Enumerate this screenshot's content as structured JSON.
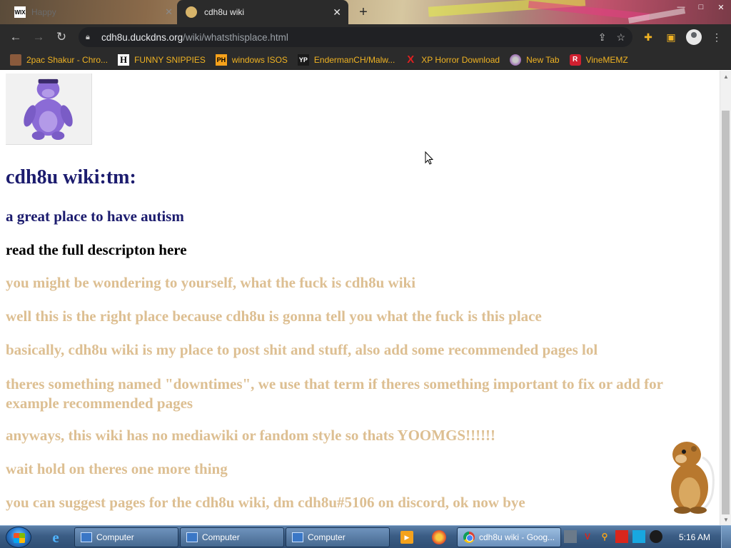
{
  "tabs": [
    {
      "title": "Happy",
      "favicon": "wix-icon",
      "active": false
    },
    {
      "title": "cdh8u wiki",
      "favicon": "site-icon",
      "active": true
    }
  ],
  "window_controls": {
    "minimize": "—",
    "maximize": "□",
    "close": "✕"
  },
  "address_bar": {
    "domain": "cdh8u.duckdns.org",
    "path": "/wiki/whatsthisplace.html"
  },
  "bookmarks": [
    {
      "label": "2pac Shakur - Chro...",
      "icon": "bookmark-photo-icon"
    },
    {
      "label": "FUNNY SNIPPIES",
      "icon": "h-letter-icon",
      "icon_text": "H"
    },
    {
      "label": "windows ISOS",
      "icon": "ph-icon",
      "icon_text": "PH"
    },
    {
      "label": "EndermanCH/Malw...",
      "icon": "yp-icon",
      "icon_text": "YP"
    },
    {
      "label": "XP Horror Download",
      "icon": "x-icon",
      "icon_text": "X"
    },
    {
      "label": "New Tab",
      "icon": "globe-icon"
    },
    {
      "label": "VineMEMZ",
      "icon": "r-icon",
      "icon_text": "R"
    }
  ],
  "page": {
    "title": "cdh8u wiki:tm:",
    "tagline": "a great place to have autism",
    "read_more": "read the full descripton here",
    "paragraphs": [
      "you might be wondering to yourself, what the fuck is cdh8u wiki",
      "well this is the right place because cdh8u is gonna tell you what the fuck is this place",
      "basically, cdh8u wiki is my place to post shit and stuff, also add some recommended pages lol",
      "theres something named \"downtimes\", we use that term if theres something important to fix or add for example recommended pages",
      "anyways, this wiki has no mediawiki or fandom style so thats YOOMGS!!!!!!",
      "wait hold on theres one more thing",
      "you can suggest pages for the cdh8u wiki, dm cdh8u#5106 on discord, ok now bye"
    ]
  },
  "taskbar": {
    "tasks": [
      {
        "label": "Computer"
      },
      {
        "label": "Computer"
      },
      {
        "label": "Computer"
      },
      {
        "label": "cdh8u wiki - Goog..."
      }
    ],
    "clock": "5:16 AM"
  },
  "colors": {
    "heading": "#1c1c6e",
    "body_text": "#ddbf92",
    "chrome_dark": "#2b2b2b",
    "bookmark_text": "#f0b323"
  }
}
